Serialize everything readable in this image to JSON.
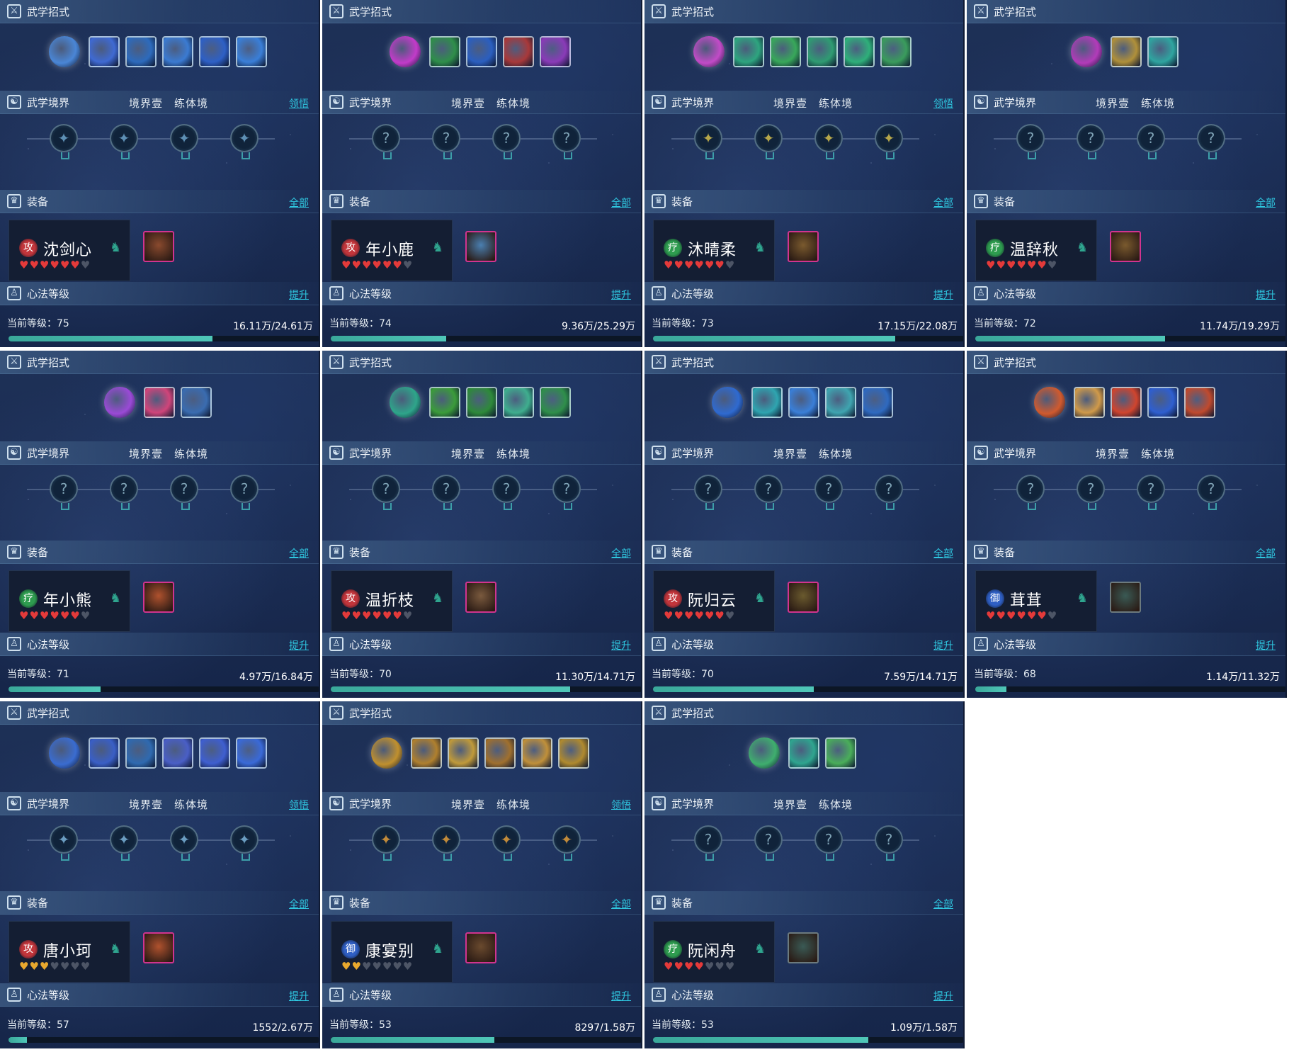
{
  "labels": {
    "skills_header": "武学招式",
    "realm_header": "武学境界",
    "realm_status": "境界壹　练体境",
    "realm_action": "领悟",
    "equip_header": "装备",
    "equip_action": "全部",
    "xinfa_header": "心法等级",
    "xinfa_action": "提升",
    "level_prefix": "当前等级："
  },
  "panels": [
    {
      "name": "沈剑心",
      "role": "攻",
      "role_color": "#c2353b",
      "hearts_full": 6,
      "hearts_total": 7,
      "heart_color": "#e43a3a",
      "level": "75",
      "exp": "16.11万/24.61万",
      "exp_fraction": 0.655,
      "realm_action": true,
      "realm_nodes": "lit",
      "node_color": "#5d8fb4",
      "skill_colors": [
        "#4a86d6",
        "#3f6ad3",
        "#2d6bbd",
        "#3b7bd2",
        "#2e60c6",
        "#3a7fd8"
      ],
      "gear_color": "#8a4a2e",
      "gear_style": "pink"
    },
    {
      "name": "年小鹿",
      "role": "攻",
      "role_color": "#c2353b",
      "hearts_full": 6,
      "hearts_total": 7,
      "heart_color": "#e43a3a",
      "level": "74",
      "exp": "9.36万/25.29万",
      "exp_fraction": 0.37,
      "realm_action": false,
      "realm_nodes": "locked",
      "node_color": "#7ea2b5",
      "skill_colors": [
        "#c23bc9",
        "#2f8f4a",
        "#2b5fc0",
        "#a8393a",
        "#8a3bb8"
      ],
      "gear_color": "#4a7fb0",
      "gear_style": "pink"
    },
    {
      "name": "沐晴柔",
      "role": "疗",
      "role_color": "#2e9c4f",
      "hearts_full": 6,
      "hearts_total": 7,
      "heart_color": "#e43a3a",
      "level": "73",
      "exp": "17.15万/22.08万",
      "exp_fraction": 0.777,
      "realm_action": true,
      "realm_nodes": "lit",
      "node_color": "#b5a64a",
      "skill_colors": [
        "#c24bc7",
        "#2ea57f",
        "#38a85a",
        "#2f9c72",
        "#2fb07a",
        "#3a9c5c"
      ],
      "gear_color": "#7a5a2e",
      "gear_style": "pink"
    },
    {
      "name": "温辞秋",
      "role": "疗",
      "role_color": "#2e9c4f",
      "hearts_full": 6,
      "hearts_total": 7,
      "heart_color": "#e43a3a",
      "level": "72",
      "exp": "11.74万/19.29万",
      "exp_fraction": 0.609,
      "realm_action": false,
      "realm_nodes": "locked",
      "node_color": "#7ea2b5",
      "skill_colors": [
        "#b23bb9",
        "#b0903a",
        "#2fa5a0"
      ],
      "gear_color": "#7a5a2e",
      "gear_style": "pink"
    },
    {
      "name": "年小熊",
      "role": "疗",
      "role_color": "#2e9c4f",
      "hearts_full": 6,
      "hearts_total": 7,
      "heart_color": "#e43a3a",
      "level": "71",
      "exp": "4.97万/16.84万",
      "exp_fraction": 0.295,
      "realm_action": false,
      "realm_nodes": "locked",
      "node_color": "#7ea2b5",
      "skill_colors": [
        "#9a4ad6",
        "#d0457a",
        "#3a6cb0"
      ],
      "gear_color": "#b0522e",
      "gear_style": "pink"
    },
    {
      "name": "温折枝",
      "role": "攻",
      "role_color": "#c2353b",
      "hearts_full": 6,
      "hearts_total": 7,
      "heart_color": "#e43a3a",
      "level": "70",
      "exp": "11.30万/14.71万",
      "exp_fraction": 0.768,
      "realm_action": false,
      "realm_nodes": "locked",
      "node_color": "#7ea2b5",
      "skill_colors": [
        "#2ea58a",
        "#3b9c3a",
        "#2e8a3a",
        "#3fae8e",
        "#2f8f4a"
      ],
      "gear_color": "#7a5a3e",
      "gear_style": "pink"
    },
    {
      "name": "阮归云",
      "role": "攻",
      "role_color": "#c2353b",
      "hearts_full": 6,
      "hearts_total": 7,
      "heart_color": "#e43a3a",
      "level": "70",
      "exp": "7.59万/14.71万",
      "exp_fraction": 0.516,
      "realm_action": false,
      "realm_nodes": "locked",
      "node_color": "#7ea2b5",
      "skill_colors": [
        "#2f6ad0",
        "#2fa5b0",
        "#3a7fd8",
        "#3fa5b0",
        "#2f6ac0"
      ],
      "gear_color": "#6a5a2e",
      "gear_style": "pink"
    },
    {
      "name": "茸茸",
      "role": "御",
      "role_color": "#2f5fc4",
      "hearts_full": 6,
      "hearts_total": 7,
      "heart_color": "#e43a3a",
      "level": "68",
      "exp": "1.14万/11.32万",
      "exp_fraction": 0.1,
      "realm_action": false,
      "realm_nodes": "locked",
      "node_color": "#7ea2b5",
      "skill_colors": [
        "#d05a2e",
        "#d09a4a",
        "#d0452e",
        "#2f5fd0",
        "#c04a2e"
      ],
      "gear_color": "#3a5a55",
      "gear_style": "plain"
    },
    {
      "name": "唐小珂",
      "role": "攻",
      "role_color": "#c2353b",
      "hearts_full": 3,
      "hearts_total": 7,
      "heart_color": "#e8a82e",
      "level": "57",
      "exp": "1552/2.67万",
      "exp_fraction": 0.058,
      "realm_action": true,
      "realm_nodes": "lit",
      "node_color": "#6a9cc0",
      "skill_colors": [
        "#3a6cd0",
        "#3a5fc6",
        "#2f6ab0",
        "#4a5fc6",
        "#3f5fd0",
        "#3a6ad8"
      ],
      "gear_color": "#b0522e",
      "gear_style": "pink"
    },
    {
      "name": "康宴别",
      "role": "御",
      "role_color": "#2f5fc4",
      "hearts_full": 2,
      "hearts_total": 7,
      "heart_color": "#e8a82e",
      "level": "53",
      "exp": "8297/1.58万",
      "exp_fraction": 0.525,
      "realm_action": true,
      "realm_nodes": "lit",
      "node_color": "#c08a3a",
      "skill_colors": [
        "#c0902e",
        "#b0802e",
        "#c09a3a",
        "#a0702e",
        "#c0903a",
        "#b08a2e"
      ],
      "gear_color": "#6a4a2e",
      "gear_style": "pink"
    },
    {
      "name": "阮闲舟",
      "role": "疗",
      "role_color": "#2e9c4f",
      "hearts_full": 4,
      "hearts_total": 7,
      "heart_color": "#e43a3a",
      "level": "53",
      "exp": "1.09万/1.58万",
      "exp_fraction": 0.69,
      "realm_action": false,
      "realm_nodes": "locked",
      "node_color": "#7ea2b5",
      "skill_colors": [
        "#3fae6e",
        "#2fa58f",
        "#4aae5a"
      ],
      "gear_color": "#3a5a55",
      "gear_style": "plain"
    }
  ]
}
